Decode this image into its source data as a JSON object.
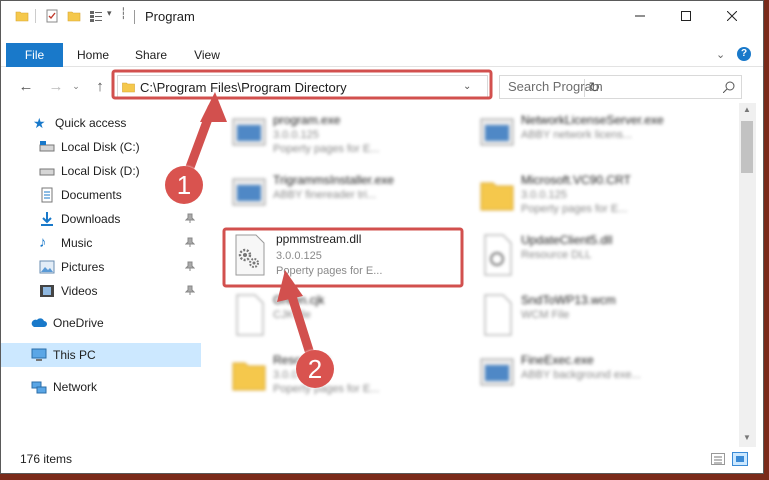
{
  "window": {
    "title": "Program"
  },
  "ribbon": {
    "tabs": [
      "File",
      "Home",
      "Share",
      "View"
    ]
  },
  "address": {
    "path": "C:\\Program Files\\Program Directory",
    "search_placeholder": "Search Program"
  },
  "nav": {
    "quick_access": "Quick access",
    "items": [
      "Local Disk (C:)",
      "Local Disk (D:)",
      "Documents",
      "Downloads",
      "Music",
      "Pictures",
      "Videos"
    ],
    "onedrive": "OneDrive",
    "this_pc": "This PC",
    "network": "Network"
  },
  "files": [
    {
      "name": "program.exe",
      "line2": "3.0.0.125",
      "line3": "Poperty pages for E..."
    },
    {
      "name": "NetworkLicenseServer.exe",
      "line2": "ABBY network licens...",
      "line3": ""
    },
    {
      "name": "TrigrammsInstaller.exe",
      "line2": "ABBY finereader tri...",
      "line3": ""
    },
    {
      "name": "Microsoft.VC90.CRT",
      "line2": "3.0.0.125",
      "line3": "Poperty pages for E..."
    },
    {
      "name": "UpdateClient5.dll",
      "line2": "Resource DLL",
      "line3": ""
    },
    {
      "name": "Green.cjk",
      "line2": "CJK file",
      "line3": ""
    },
    {
      "name": "SndToWP13.wcm",
      "line2": "WCM File",
      "line3": ""
    },
    {
      "name": "Resources",
      "line2": "3.0.0.125",
      "line3": "Poperty pages for E..."
    },
    {
      "name": "FineExec.exe",
      "line2": "ABBY background exe...",
      "line3": ""
    }
  ],
  "focus_file": {
    "name": "ppmmstream.dll",
    "version": "3.0.0.125",
    "desc": "Poperty pages for E..."
  },
  "status": {
    "count": "176 items"
  },
  "annotations": {
    "badge1": "1",
    "badge2": "2",
    "color": "#d2504e"
  },
  "colors": {
    "accent": "#1979ca",
    "selected": "#cce8ff"
  }
}
